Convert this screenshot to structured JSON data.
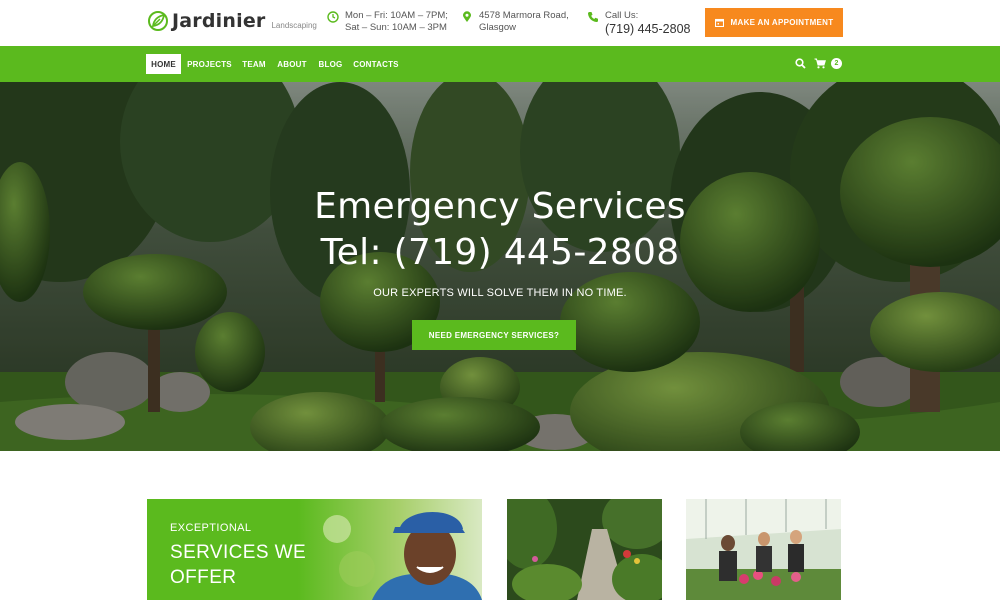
{
  "brand": {
    "name": "Jardinier",
    "tagline": "Landscaping",
    "accent_color": "#5bba1e",
    "cta_color": "#f7891e"
  },
  "header": {
    "hours": {
      "icon": "clock-icon",
      "line1": "Mon – Fri: 10AM – 7PM;",
      "line2": "Sat – Sun: 10AM – 3PM"
    },
    "address": {
      "icon": "map-pin-icon",
      "line1": "4578 Marmora Road,",
      "line2": "Glasgow"
    },
    "phone": {
      "icon": "phone-icon",
      "label": "Call Us:",
      "number": "(719) 445-2808"
    },
    "appointment_button": {
      "icon": "calendar-icon",
      "label": "MAKE AN APPOINTMENT"
    }
  },
  "nav": {
    "items": [
      {
        "label": "HOME",
        "active": true
      },
      {
        "label": "PROJECTS",
        "active": false
      },
      {
        "label": "TEAM",
        "active": false
      },
      {
        "label": "ABOUT",
        "active": false
      },
      {
        "label": "BLOG",
        "active": false
      },
      {
        "label": "CONTACTS",
        "active": false
      }
    ],
    "search_icon": "search-icon",
    "cart_icon": "cart-icon",
    "cart_count": "2"
  },
  "hero": {
    "title_line1": "Emergency Services",
    "title_line2": "Tel: (719) 445-2808",
    "subtitle": "OUR EXPERTS WILL SOLVE THEM IN NO TIME.",
    "button_label": "NEED EMERGENCY SERVICES?"
  },
  "services": {
    "kicker": "EXCEPTIONAL",
    "title": "SERVICES WE OFFER"
  }
}
